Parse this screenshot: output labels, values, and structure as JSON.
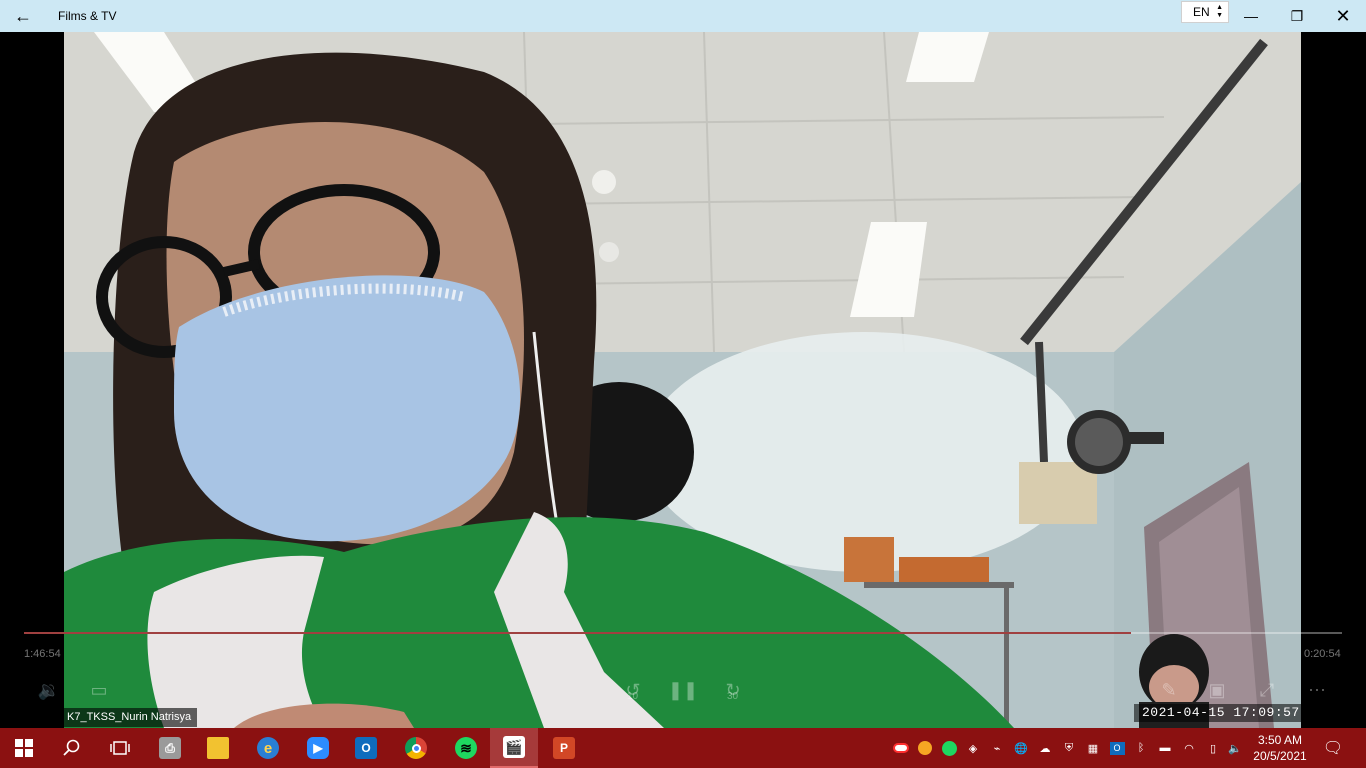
{
  "titlebar": {
    "back_glyph": "←",
    "title": "Films & TV",
    "language": "EN",
    "minimize_glyph": "—",
    "maximize_glyph": "❐",
    "close_glyph": "✕"
  },
  "player": {
    "elapsed": "1:46:54",
    "remaining": "0:20:54",
    "progress_fraction": 0.84,
    "skip_back_label": "10",
    "skip_forward_label": "30",
    "participant_name": "K7_TKSS_Nurin Natrisya",
    "video_timestamp": "2021-04-15  17:09:57"
  },
  "taskbar": {
    "colors": {
      "background": "#8b1111",
      "active": "#a63a3a"
    },
    "apps": [
      {
        "name": "start",
        "icon": "windows-icon"
      },
      {
        "name": "search",
        "icon": "search-icon"
      },
      {
        "name": "task-view",
        "icon": "task-view-icon"
      },
      {
        "name": "fax",
        "icon": "fax-icon"
      },
      {
        "name": "file-explorer",
        "icon": "folder-icon"
      },
      {
        "name": "internet-explorer",
        "icon": "ie-icon"
      },
      {
        "name": "zoom",
        "icon": "zoom-icon"
      },
      {
        "name": "outlook",
        "icon": "outlook-icon"
      },
      {
        "name": "chrome",
        "icon": "chrome-icon"
      },
      {
        "name": "spotify",
        "icon": "spotify-icon"
      },
      {
        "name": "films-tv",
        "icon": "clapperboard-icon",
        "active": true
      },
      {
        "name": "powerpoint",
        "icon": "powerpoint-icon"
      }
    ],
    "clock_time": "3:50 AM",
    "clock_date": "20/5/2021"
  }
}
